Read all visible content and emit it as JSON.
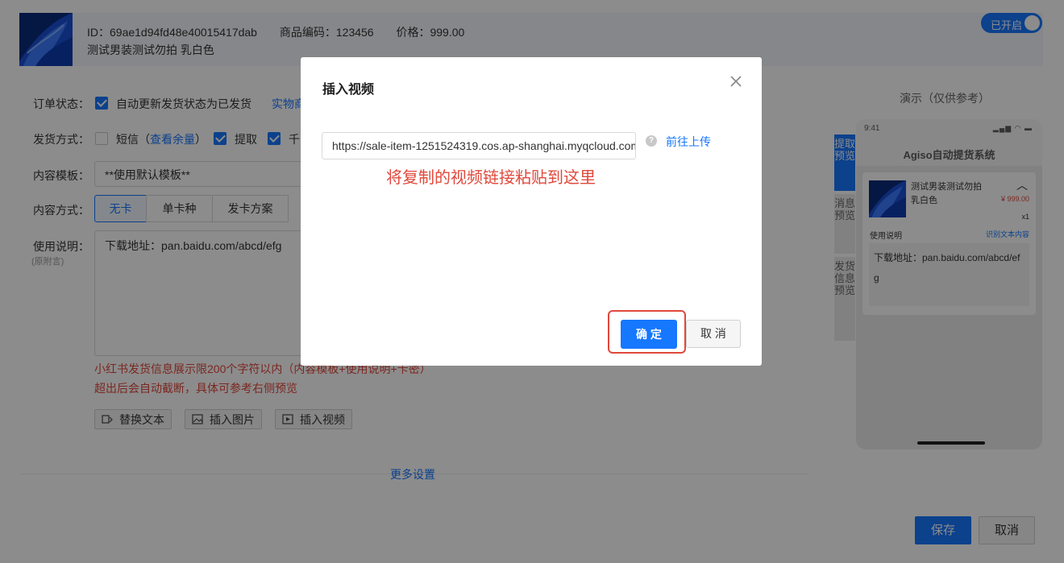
{
  "product": {
    "id_label": "ID：69ae1d94fd48e40015417dab",
    "code_label": "商品编码：123456",
    "price_label": "价格：999.00",
    "name": "测试男装测试勿拍 乳白色",
    "toggle_label": "已开启"
  },
  "form": {
    "order_status_label": "订单状态：",
    "auto_update_text": "自动更新发货状态为已发货",
    "physical_link": "实物商",
    "delivery_method_label": "发货方式：",
    "sms_label": "短信（",
    "check_balance": "查看余量",
    "sms_close": "）",
    "pickup_label": "提取",
    "qianniu_label": "千",
    "template_label": "内容模板：",
    "template_value": "**使用默认模板**",
    "content_method_label": "内容方式：",
    "segments": [
      "无卡",
      "单卡种",
      "发卡方案"
    ],
    "usage_label": "使用说明：",
    "usage_sub": "(原附言)",
    "usage_value": "下载地址：pan.baidu.com/abcd/efg",
    "warning_line1": "小红书发货信息展示限200个字符以内（内容模板+使用说明+卡密）",
    "warning_line2": "超出后会自动截断，具体可参考右侧预览",
    "tools": [
      "替换文本",
      "插入图片",
      "插入视频"
    ],
    "more_settings": "更多设置"
  },
  "preview": {
    "title": "演示（仅供参考）",
    "tabs": [
      "提取预览",
      "消息预览",
      "发货信息预览"
    ],
    "time": "9:41",
    "status_icons": "▂▄▆ ◠ ▬",
    "app_title": "Agiso自动提货系统",
    "product_name": "测试男装测试勿拍 乳白色",
    "price": "¥ 999.00",
    "qty": "x1",
    "usage_label": "使用说明",
    "recognize_link": "识别文本内容",
    "content": "下载地址：pan.baidu.com/abcd/efg"
  },
  "footer": {
    "save": "保存",
    "cancel": "取消"
  },
  "modal": {
    "title": "插入视频",
    "url_value": "https://sale-item-1251524319.cos.ap-shanghai.myqcloud.com/",
    "upload_link": "前往上传",
    "annotation": "将复制的视频链接粘贴到这里",
    "ok": "确 定",
    "cancel": "取 消"
  },
  "colors": {
    "accent": "#1677ff",
    "warning": "#e0483c"
  }
}
